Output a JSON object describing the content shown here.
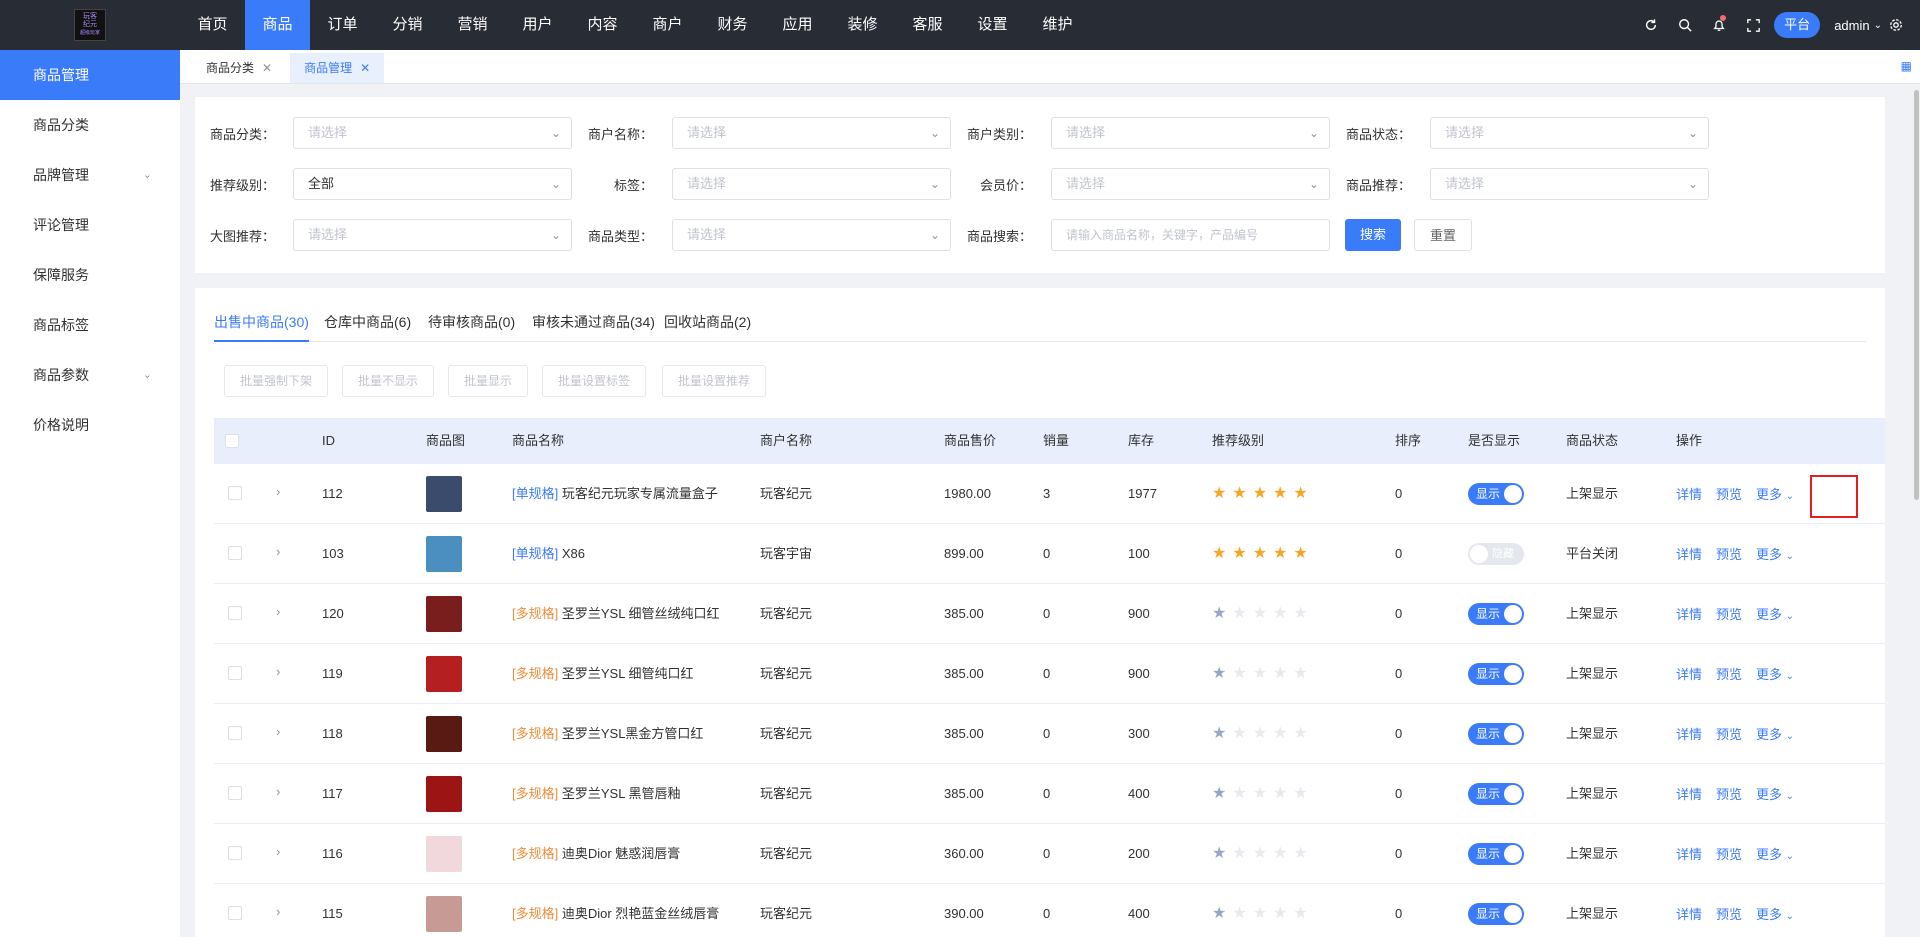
{
  "topbar": {
    "logo_lines": [
      "玩客",
      "纪元",
      "超级玩家"
    ],
    "nav": [
      "首页",
      "商品",
      "订单",
      "分销",
      "营销",
      "用户",
      "内容",
      "商户",
      "财务",
      "应用",
      "装修",
      "客服",
      "设置",
      "维护"
    ],
    "active_nav": "商品",
    "platform_label": "平台",
    "user": "admin"
  },
  "sidebar": {
    "items": [
      {
        "label": "商品管理",
        "active": true,
        "has_children": false
      },
      {
        "label": "商品分类",
        "active": false,
        "has_children": false
      },
      {
        "label": "品牌管理",
        "active": false,
        "has_children": true
      },
      {
        "label": "评论管理",
        "active": false,
        "has_children": false
      },
      {
        "label": "保障服务",
        "active": false,
        "has_children": false
      },
      {
        "label": "商品标签",
        "active": false,
        "has_children": false
      },
      {
        "label": "商品参数",
        "active": false,
        "has_children": true
      },
      {
        "label": "价格说明",
        "active": false,
        "has_children": false
      }
    ]
  },
  "page_tabs": [
    {
      "label": "商品分类",
      "active": false
    },
    {
      "label": "商品管理",
      "active": true
    }
  ],
  "filters": {
    "category": {
      "label": "商品分类：",
      "placeholder": "请选择",
      "value": ""
    },
    "merchant_name": {
      "label": "商户名称：",
      "placeholder": "请选择",
      "value": ""
    },
    "merchant_type": {
      "label": "商户类别：",
      "placeholder": "请选择",
      "value": ""
    },
    "product_status": {
      "label": "商品状态：",
      "placeholder": "请选择",
      "value": ""
    },
    "recommend_level": {
      "label": "推荐级别：",
      "placeholder": "请选择",
      "value": "全部"
    },
    "tag": {
      "label": "标签：",
      "placeholder": "请选择",
      "value": ""
    },
    "member_price": {
      "label": "会员价：",
      "placeholder": "请选择",
      "value": ""
    },
    "product_recommend": {
      "label": "商品推荐：",
      "placeholder": "请选择",
      "value": ""
    },
    "big_image_recommend": {
      "label": "大图推荐：",
      "placeholder": "请选择",
      "value": ""
    },
    "product_type": {
      "label": "商品类型：",
      "placeholder": "请选择",
      "value": ""
    },
    "search": {
      "label": "商品搜索：",
      "placeholder": "请输入商品名称，关键字，产品编号",
      "value": ""
    },
    "search_button": "搜索",
    "reset_button": "重置"
  },
  "status_tabs": [
    {
      "label": "出售中商品(30)",
      "active": true
    },
    {
      "label": "仓库中商品(6)",
      "active": false
    },
    {
      "label": "待审核商品(0)",
      "active": false
    },
    {
      "label": "审核未通过商品(34)",
      "active": false
    },
    {
      "label": "回收站商品(2)",
      "active": false
    }
  ],
  "batch_buttons": [
    "批量强制下架",
    "批量不显示",
    "批量显示",
    "批量设置标签",
    "批量设置推荐"
  ],
  "table": {
    "headers": [
      "ID",
      "商品图",
      "商品名称",
      "商户名称",
      "商品售价",
      "销量",
      "库存",
      "推荐级别",
      "排序",
      "是否显示",
      "商品状态",
      "操作"
    ],
    "rows": [
      {
        "id": "112",
        "tag": "[单规格]",
        "tag_type": "single",
        "name": "玩客纪元玩家专属流量盒子",
        "merchant": "玩客纪元",
        "price": "1980.00",
        "sales": "3",
        "stock": "1977",
        "stars": 5,
        "sort": "0",
        "show": true,
        "show_label": "显示",
        "status": "上架显示",
        "thumb_color": "#3b4b6b"
      },
      {
        "id": "103",
        "tag": "[单规格]",
        "tag_type": "single",
        "name": "X86",
        "merchant": "玩客宇宙",
        "price": "899.00",
        "sales": "0",
        "stock": "100",
        "stars": 5,
        "sort": "0",
        "show": false,
        "show_label": "隐藏",
        "status": "平台关闭",
        "thumb_color": "#4a8fc0"
      },
      {
        "id": "120",
        "tag": "[多规格]",
        "tag_type": "multi",
        "name": "圣罗兰YSL 细管丝绒纯口红",
        "merchant": "玩客纪元",
        "price": "385.00",
        "sales": "0",
        "stock": "900",
        "stars": 1,
        "sort": "0",
        "show": true,
        "show_label": "显示",
        "status": "上架显示",
        "thumb_color": "#7a1d1d"
      },
      {
        "id": "119",
        "tag": "[多规格]",
        "tag_type": "multi",
        "name": "圣罗兰YSL 细管纯口红",
        "merchant": "玩客纪元",
        "price": "385.00",
        "sales": "0",
        "stock": "900",
        "stars": 1,
        "sort": "0",
        "show": true,
        "show_label": "显示",
        "status": "上架显示",
        "thumb_color": "#b3201f"
      },
      {
        "id": "118",
        "tag": "[多规格]",
        "tag_type": "multi",
        "name": "圣罗兰YSL黑金方管口红",
        "merchant": "玩客纪元",
        "price": "385.00",
        "sales": "0",
        "stock": "300",
        "stars": 1,
        "sort": "0",
        "show": true,
        "show_label": "显示",
        "status": "上架显示",
        "thumb_color": "#5a1a14"
      },
      {
        "id": "117",
        "tag": "[多规格]",
        "tag_type": "multi",
        "name": "圣罗兰YSL 黑管唇釉",
        "merchant": "玩客纪元",
        "price": "385.00",
        "sales": "0",
        "stock": "400",
        "stars": 1,
        "sort": "0",
        "show": true,
        "show_label": "显示",
        "status": "上架显示",
        "thumb_color": "#9c1414"
      },
      {
        "id": "116",
        "tag": "[多规格]",
        "tag_type": "multi",
        "name": "迪奥Dior 魅惑润唇膏",
        "merchant": "玩客纪元",
        "price": "360.00",
        "sales": "0",
        "stock": "200",
        "stars": 1,
        "sort": "0",
        "show": true,
        "show_label": "显示",
        "status": "上架显示",
        "thumb_color": "#f1d8dc"
      },
      {
        "id": "115",
        "tag": "[多规格]",
        "tag_type": "multi",
        "name": "迪奥Dior 烈艳蓝金丝绒唇膏",
        "merchant": "玩客纪元",
        "price": "390.00",
        "sales": "0",
        "stock": "400",
        "stars": 1,
        "sort": "0",
        "show": true,
        "show_label": "显示",
        "status": "上架显示",
        "thumb_color": "#c89a96"
      }
    ],
    "ops": {
      "detail": "详情",
      "preview": "预览",
      "more": "更多"
    }
  }
}
